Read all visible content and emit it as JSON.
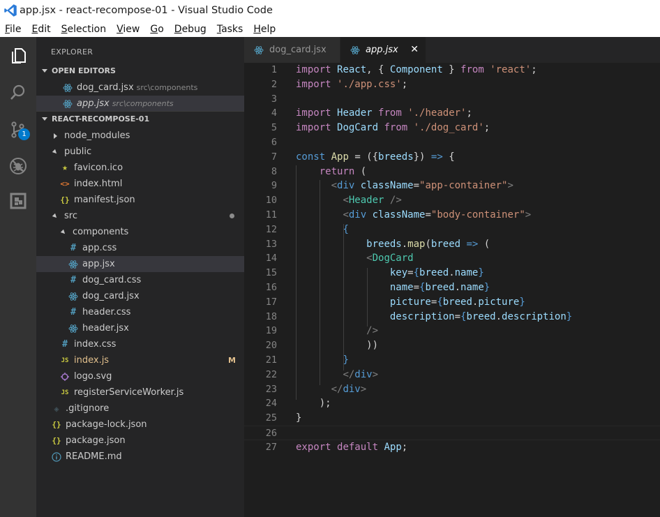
{
  "window": {
    "title": "app.jsx - react-recompose-01 - Visual Studio Code"
  },
  "menu": [
    {
      "u": "F",
      "rest": "ile"
    },
    {
      "u": "E",
      "rest": "dit"
    },
    {
      "u": "S",
      "rest": "election"
    },
    {
      "u": "V",
      "rest": "iew"
    },
    {
      "u": "G",
      "rest": "o"
    },
    {
      "u": "D",
      "rest": "ebug"
    },
    {
      "u": "T",
      "rest": "asks"
    },
    {
      "u": "H",
      "rest": "elp"
    }
  ],
  "activity": {
    "scm_badge": "1"
  },
  "sidebar": {
    "title": "EXPLORER",
    "open_editors_header": "OPEN EDITORS",
    "open_editors": [
      {
        "name": "dog_card.jsx",
        "path": "src\\components"
      },
      {
        "name": "app.jsx",
        "path": "src\\components"
      }
    ],
    "project_header": "REACT-RECOMPOSE-01",
    "tree": [
      {
        "name": "node_modules",
        "type": "folder-closed",
        "icon": ""
      },
      {
        "name": "public",
        "type": "folder-open",
        "icon": ""
      },
      {
        "name": "favicon.ico",
        "type": "file",
        "icon": "star-icon"
      },
      {
        "name": "index.html",
        "type": "file",
        "icon": "html-icon"
      },
      {
        "name": "manifest.json",
        "type": "file",
        "icon": "json-icon"
      },
      {
        "name": "src",
        "type": "folder-open",
        "icon": ""
      },
      {
        "name": "components",
        "type": "folder-open",
        "icon": ""
      },
      {
        "name": "app.css",
        "type": "file",
        "icon": "css-icon"
      },
      {
        "name": "app.jsx",
        "type": "file",
        "icon": "react-icon"
      },
      {
        "name": "dog_card.css",
        "type": "file",
        "icon": "css-icon"
      },
      {
        "name": "dog_card.jsx",
        "type": "file",
        "icon": "react-icon"
      },
      {
        "name": "header.css",
        "type": "file",
        "icon": "css-icon"
      },
      {
        "name": "header.jsx",
        "type": "file",
        "icon": "react-icon"
      },
      {
        "name": "index.css",
        "type": "file",
        "icon": "css-icon"
      },
      {
        "name": "index.js",
        "type": "file",
        "icon": "js-icon",
        "status": "M"
      },
      {
        "name": "logo.svg",
        "type": "file",
        "icon": "svg-icon"
      },
      {
        "name": "registerServiceWorker.js",
        "type": "file",
        "icon": "js-icon"
      },
      {
        "name": ".gitignore",
        "type": "file",
        "icon": "git-icon"
      },
      {
        "name": "package-lock.json",
        "type": "file",
        "icon": "json-icon"
      },
      {
        "name": "package.json",
        "type": "file",
        "icon": "json-icon"
      },
      {
        "name": "README.md",
        "type": "file",
        "icon": "info-icon"
      }
    ]
  },
  "tabs": [
    {
      "label": "dog_card.jsx"
    },
    {
      "label": "app.jsx"
    }
  ],
  "tab_close_glyph": "✕",
  "editor": {
    "lines": [
      [
        [
          "kw",
          "import"
        ],
        [
          "pn",
          " "
        ],
        [
          "id",
          "React"
        ],
        [
          "pn",
          ", { "
        ],
        [
          "id",
          "Component"
        ],
        [
          "pn",
          " } "
        ],
        [
          "kw",
          "from"
        ],
        [
          "pn",
          " "
        ],
        [
          "str",
          "'react'"
        ],
        [
          "pn",
          ";"
        ]
      ],
      [
        [
          "kw",
          "import"
        ],
        [
          "pn",
          " "
        ],
        [
          "str",
          "'./app.css'"
        ],
        [
          "pn",
          ";"
        ]
      ],
      [],
      [
        [
          "kw",
          "import"
        ],
        [
          "pn",
          " "
        ],
        [
          "id",
          "Header"
        ],
        [
          "pn",
          " "
        ],
        [
          "kw",
          "from"
        ],
        [
          "pn",
          " "
        ],
        [
          "str",
          "'./header'"
        ],
        [
          "pn",
          ";"
        ]
      ],
      [
        [
          "kw",
          "import"
        ],
        [
          "pn",
          " "
        ],
        [
          "id",
          "DogCard"
        ],
        [
          "pn",
          " "
        ],
        [
          "kw",
          "from"
        ],
        [
          "pn",
          " "
        ],
        [
          "str",
          "'./dog_card'"
        ],
        [
          "pn",
          ";"
        ]
      ],
      [],
      [
        [
          "bl",
          "const"
        ],
        [
          "pn",
          " "
        ],
        [
          "fn",
          "App"
        ],
        [
          "pn",
          " = ({"
        ],
        [
          "id",
          "breeds"
        ],
        [
          "pn",
          "}) "
        ],
        [
          "bl",
          "=>"
        ],
        [
          "pn",
          " {"
        ]
      ],
      [
        [
          "pn",
          "    "
        ],
        [
          "kw",
          "return"
        ],
        [
          "pn",
          " ("
        ]
      ],
      [
        [
          "pn",
          "      "
        ],
        [
          "tg",
          "<"
        ],
        [
          "bl",
          "div"
        ],
        [
          "pn",
          " "
        ],
        [
          "id",
          "className"
        ],
        [
          "pn",
          "="
        ],
        [
          "str",
          "\"app-container\""
        ],
        [
          "tg",
          ">"
        ]
      ],
      [
        [
          "pn",
          "        "
        ],
        [
          "tg",
          "<"
        ],
        [
          "cls",
          "Header"
        ],
        [
          "pn",
          " "
        ],
        [
          "tg",
          "/>"
        ]
      ],
      [
        [
          "pn",
          "        "
        ],
        [
          "tg",
          "<"
        ],
        [
          "bl",
          "div"
        ],
        [
          "pn",
          " "
        ],
        [
          "id",
          "className"
        ],
        [
          "pn",
          "="
        ],
        [
          "str",
          "\"body-container\""
        ],
        [
          "tg",
          ">"
        ]
      ],
      [
        [
          "pn",
          "        "
        ],
        [
          "bl",
          "{"
        ]
      ],
      [
        [
          "pn",
          "            "
        ],
        [
          "id",
          "breeds"
        ],
        [
          "pn",
          "."
        ],
        [
          "fn",
          "map"
        ],
        [
          "pn",
          "("
        ],
        [
          "id",
          "breed"
        ],
        [
          "pn",
          " "
        ],
        [
          "bl",
          "=>"
        ],
        [
          "pn",
          " ("
        ]
      ],
      [
        [
          "pn",
          "            "
        ],
        [
          "tg",
          "<"
        ],
        [
          "cls",
          "DogCard"
        ]
      ],
      [
        [
          "pn",
          "                "
        ],
        [
          "id",
          "key"
        ],
        [
          "pn",
          "="
        ],
        [
          "bl",
          "{"
        ],
        [
          "id",
          "breed"
        ],
        [
          "pn",
          "."
        ],
        [
          "id",
          "name"
        ],
        [
          "bl",
          "}"
        ]
      ],
      [
        [
          "pn",
          "                "
        ],
        [
          "id",
          "name"
        ],
        [
          "pn",
          "="
        ],
        [
          "bl",
          "{"
        ],
        [
          "id",
          "breed"
        ],
        [
          "pn",
          "."
        ],
        [
          "id",
          "name"
        ],
        [
          "bl",
          "}"
        ]
      ],
      [
        [
          "pn",
          "                "
        ],
        [
          "id",
          "picture"
        ],
        [
          "pn",
          "="
        ],
        [
          "bl",
          "{"
        ],
        [
          "id",
          "breed"
        ],
        [
          "pn",
          "."
        ],
        [
          "id",
          "picture"
        ],
        [
          "bl",
          "}"
        ]
      ],
      [
        [
          "pn",
          "                "
        ],
        [
          "id",
          "description"
        ],
        [
          "pn",
          "="
        ],
        [
          "bl",
          "{"
        ],
        [
          "id",
          "breed"
        ],
        [
          "pn",
          "."
        ],
        [
          "id",
          "description"
        ],
        [
          "bl",
          "}"
        ]
      ],
      [
        [
          "pn",
          "            "
        ],
        [
          "tg",
          "/>"
        ]
      ],
      [
        [
          "pn",
          "            ))"
        ]
      ],
      [
        [
          "pn",
          "        "
        ],
        [
          "bl",
          "}"
        ]
      ],
      [
        [
          "pn",
          "        "
        ],
        [
          "tg",
          "</"
        ],
        [
          "bl",
          "div"
        ],
        [
          "tg",
          ">"
        ]
      ],
      [
        [
          "pn",
          "      "
        ],
        [
          "tg",
          "</"
        ],
        [
          "bl",
          "div"
        ],
        [
          "tg",
          ">"
        ]
      ],
      [
        [
          "pn",
          "    );"
        ]
      ],
      [
        [
          "pn",
          "}"
        ]
      ],
      [],
      [
        [
          "kw",
          "export"
        ],
        [
          "pn",
          " "
        ],
        [
          "kw",
          "default"
        ],
        [
          "pn",
          " "
        ],
        [
          "id",
          "App"
        ],
        [
          "pn",
          ";"
        ]
      ]
    ]
  },
  "colors": {
    "accent": "#007acc",
    "keyword": "#c586c0",
    "storage": "#569cd6",
    "variable": "#9cdcfe",
    "class": "#4ec9b0",
    "string": "#ce9178",
    "function": "#dcdcaa"
  }
}
